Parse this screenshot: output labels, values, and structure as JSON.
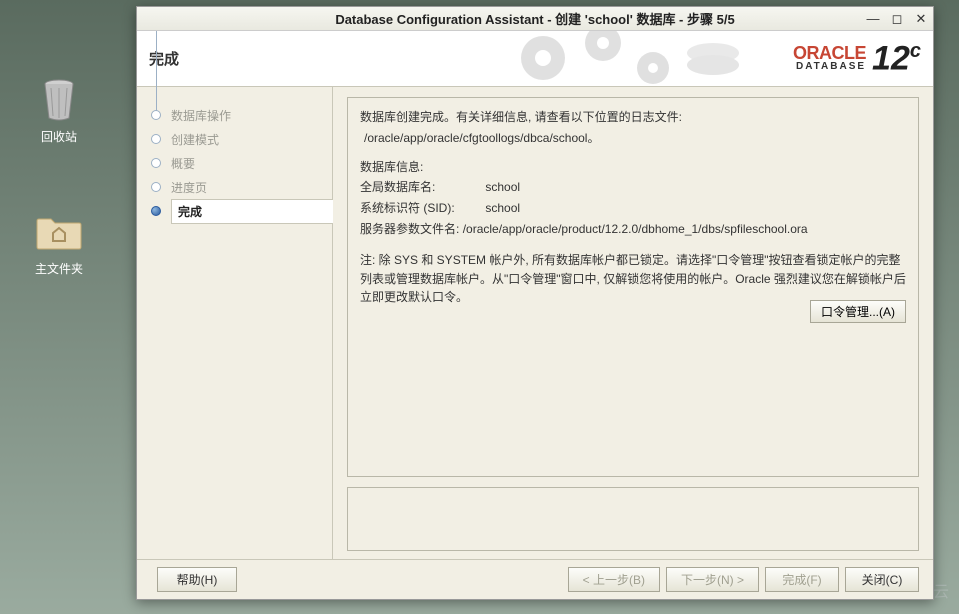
{
  "desktop": {
    "trash_label": "回收站",
    "home_label": "主文件夹"
  },
  "watermark": "亿速云",
  "window": {
    "title": "Database Configuration Assistant - 创建 'school' 数据库 - 步骤 5/5"
  },
  "header": {
    "title": "完成",
    "logo_brand": "ORACLE",
    "logo_sub": "DATABASE",
    "logo_version": "12",
    "logo_version_suffix": "c"
  },
  "sidebar": {
    "steps": [
      {
        "label": "数据库操作"
      },
      {
        "label": "创建模式"
      },
      {
        "label": "概要"
      },
      {
        "label": "进度页"
      },
      {
        "label": "完成"
      }
    ]
  },
  "main": {
    "line1": "数据库创建完成。有关详细信息, 请查看以下位置的日志文件:",
    "logpath": "/oracle/app/oracle/cfgtoollogs/dbca/school。",
    "info_header": "数据库信息:",
    "rows": [
      {
        "label": "全局数据库名:",
        "value": "school"
      },
      {
        "label": "系统标识符 (SID):",
        "value": "school"
      },
      {
        "label": "服务器参数文件名:",
        "value": "/oracle/app/oracle/product/12.2.0/dbhome_1/dbs/spfileschool.ora"
      }
    ],
    "note": "注: 除 SYS 和 SYSTEM 帐户外, 所有数据库帐户都已锁定。请选择\"口令管理\"按钮查看锁定帐户的完整列表或管理数据库帐户。从\"口令管理\"窗口中, 仅解锁您将使用的帐户。Oracle 强烈建议您在解锁帐户后立即更改默认口令。",
    "password_button": "口令管理...(A)"
  },
  "footer": {
    "help": "帮助(H)",
    "back": "< 上一步(B)",
    "next": "下一步(N) >",
    "finish": "完成(F)",
    "close": "关闭(C)"
  }
}
